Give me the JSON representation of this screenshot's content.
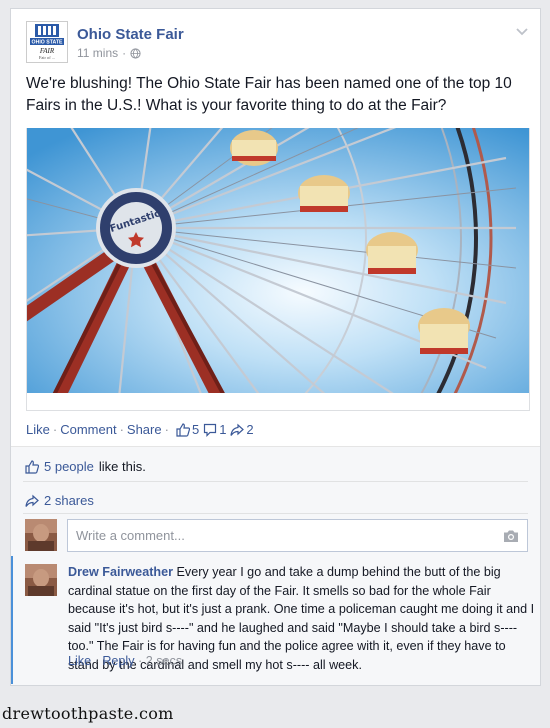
{
  "post": {
    "page_name": "Ohio State Fair",
    "time": "11 mins",
    "text": "We're blushing! The Ohio State Fair has been named one of the top 10 Fairs in the U.S.! What is your favorite thing to do at the Fair?",
    "photo": {
      "sign_text": "Funtastic"
    },
    "logo": {
      "line1": "OHIO STATE",
      "line2": "FAIR",
      "line3": "Fair of ..."
    }
  },
  "actions": {
    "like": "Like",
    "comment": "Comment",
    "share": "Share",
    "like_count": "5",
    "comment_count": "1",
    "share_count": "2"
  },
  "ufi": {
    "likes_link": "5 people",
    "likes_suffix": "like this.",
    "shares": "2 shares",
    "comment_placeholder": "Write a comment..."
  },
  "comments": [
    {
      "author": "Drew Fairweather",
      "text": "Every year I go and take a dump behind the butt of the big cardinal statue on the first day of the Fair. It smells so bad for the whole Fair because it's hot, but it's just a prank. One time a policeman caught me doing it and I said \"It's just bird s----\" and he laughed and said \"Maybe I should take a bird s---- too.\" The Fair is for having fun and the police agree with it, even if they have to stand by the cardinal and smell my hot s---- all week.",
      "like": "Like",
      "reply": "Reply",
      "time": "2 secs"
    }
  ],
  "watermark": "drewtoothpaste.com",
  "colors": {
    "link": "#3b5998",
    "meta": "#90949c",
    "sky": "#5aa9e0",
    "wheel": "#a0362a"
  }
}
